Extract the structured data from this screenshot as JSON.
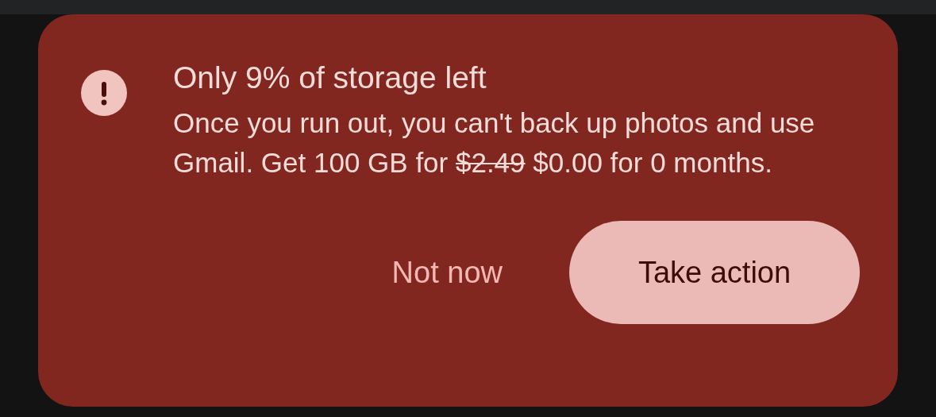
{
  "alert": {
    "title": "Only 9% of storage left",
    "message": {
      "before": "Once you run out, you can't back up photos and use Gmail. Get 100 GB for",
      "old_price": "$2.49",
      "after": "$0.00 for 0 months."
    },
    "actions": [
      {
        "label": "Not now",
        "kind": "text"
      },
      {
        "label": "Take action",
        "kind": "filled"
      }
    ]
  }
}
